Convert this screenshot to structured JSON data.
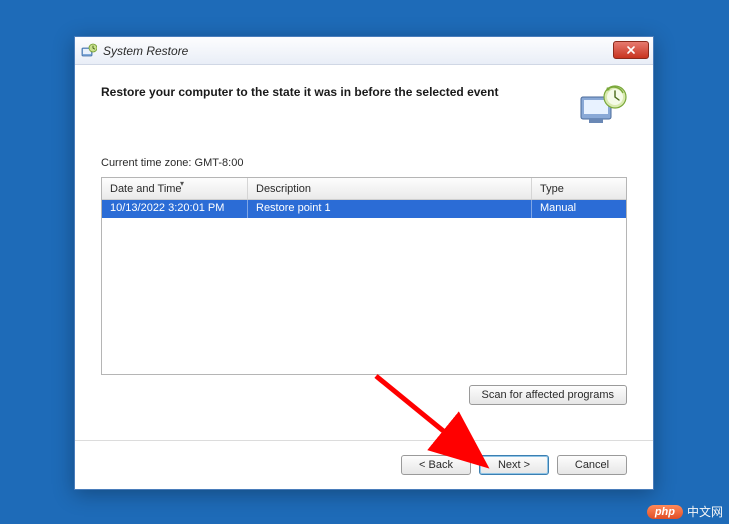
{
  "window": {
    "title": "System Restore"
  },
  "header": {
    "heading": "Restore your computer to the state it was in before the selected event"
  },
  "timezone_label": "Current time zone: GMT-8:00",
  "table": {
    "columns": {
      "date": "Date and Time",
      "desc": "Description",
      "type": "Type"
    },
    "rows": [
      {
        "date": "10/13/2022 3:20:01 PM",
        "desc": "Restore point 1",
        "type": "Manual"
      }
    ]
  },
  "buttons": {
    "scan": "Scan for affected programs",
    "back": "< Back",
    "next": "Next >",
    "cancel": "Cancel"
  },
  "watermark": {
    "badge": "php",
    "text": "中文网"
  }
}
